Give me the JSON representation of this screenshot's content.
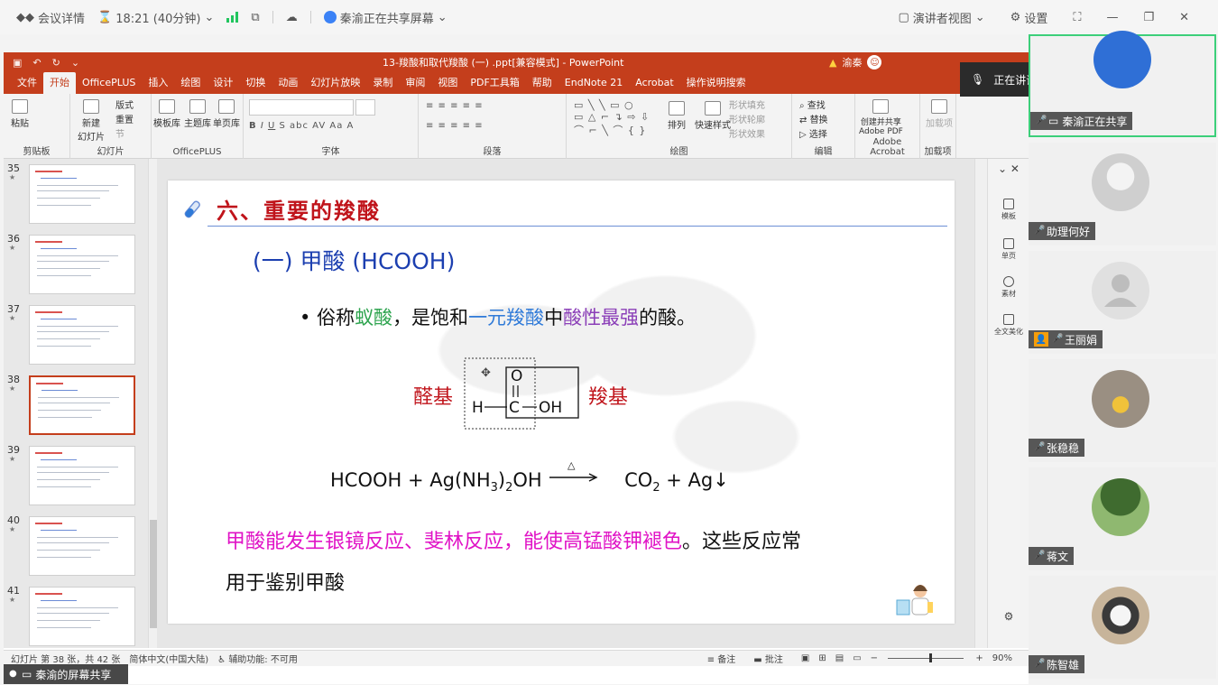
{
  "topbar": {
    "meeting_details": "会议详情",
    "time": "18:21 (40分钟)",
    "sharing": "秦渝正在共享屏幕",
    "presenter_view": "演讲者视图",
    "settings": "设置"
  },
  "ppt": {
    "title": "13-羧酸和取代羧酸 (一) .ppt[兼容模式] - PowerPoint",
    "user": "渝秦",
    "tabs": [
      "文件",
      "开始",
      "OfficePLUS",
      "插入",
      "绘图",
      "设计",
      "切换",
      "动画",
      "幻灯片放映",
      "录制",
      "审阅",
      "视图",
      "PDF工具箱",
      "帮助",
      "EndNote 21",
      "Acrobat",
      "操作说明搜索"
    ],
    "active_tab_index": 1,
    "ribbon": {
      "paste": "粘贴",
      "new_slide": "新建\n幻灯片",
      "layout": "版式",
      "reset": "重置",
      "section": "节",
      "officeplus_items": [
        "模板库",
        "主题库",
        "单页库"
      ],
      "arrange": "排列",
      "quick_styles": "快速样式",
      "shape_fill": "形状填充",
      "shape_outline": "形状轮廓",
      "shape_effects": "形状效果",
      "find": "查找",
      "replace": "替换",
      "select": "选择",
      "create_pdf": "创建并共享\nAdobe PDF",
      "addins": "加载项",
      "groups": [
        "剪贴板",
        "幻灯片",
        "OfficePLUS",
        "字体",
        "段落",
        "绘图",
        "编辑",
        "Adobe Acrobat",
        "加载项"
      ]
    },
    "thumbnails": [
      {
        "num": "35"
      },
      {
        "num": "36"
      },
      {
        "num": "37"
      },
      {
        "num": "38"
      },
      {
        "num": "39"
      },
      {
        "num": "40"
      },
      {
        "num": "41"
      }
    ],
    "active_thumb": "38",
    "slide": {
      "title": "六、重要的羧酸",
      "subtitle": "(一) 甲酸 (HCOOH)",
      "bullet_prefix": "俗称",
      "bullet_g": "蚁酸",
      "bullet_mid": "，是饱和",
      "bullet_b": "一元羧酸",
      "bullet_mid2": "中",
      "bullet_p": "酸性最强",
      "bullet_end": "的酸。",
      "aldehyde_label": "醛基",
      "carboxyl_label": "羧基",
      "struct_o": "O",
      "struct_h": "H",
      "struct_c": "C",
      "struct_oh": "OH",
      "eq_left": "HCOOH + Ag(NH",
      "eq_sub3": "3",
      "eq_mid": ")",
      "eq_sub2": "2",
      "eq_oh": "OH",
      "eq_delta": "△",
      "eq_co": "CO",
      "eq_co_sub": "2",
      "eq_right": " + Ag↓",
      "para1_pink": "甲酸能发生银镜反应、斐林反应，能使高锰酸钾褪色",
      "para1_black": "。这些反应常",
      "para2": "用于鉴别甲酸"
    },
    "side_tools": [
      "模板",
      "单页",
      "素材",
      "全文美化"
    ],
    "status": {
      "slide_info": "幻灯片 第 38 张，共 42 张",
      "lang": "简体中文(中国大陆)",
      "accessibility": "辅助功能: 不可用",
      "notes": "备注",
      "comments": "批注",
      "zoom": "90%"
    }
  },
  "speaking_tip": "正在讲话: 秦渝;",
  "screen_label": "秦渝的屏幕共享",
  "participants": [
    {
      "name": "秦渝正在共享",
      "host": false
    },
    {
      "name": "助理何好",
      "host": false
    },
    {
      "name": "王丽娟",
      "host": true
    },
    {
      "name": "张稳稳",
      "host": false
    },
    {
      "name": "蒋文",
      "host": false
    },
    {
      "name": "陈智雄",
      "host": false
    }
  ],
  "colors": {
    "ppt_red": "#c43e1c",
    "active_speaker": "#3ccf7a",
    "title_red": "#c0141b"
  }
}
